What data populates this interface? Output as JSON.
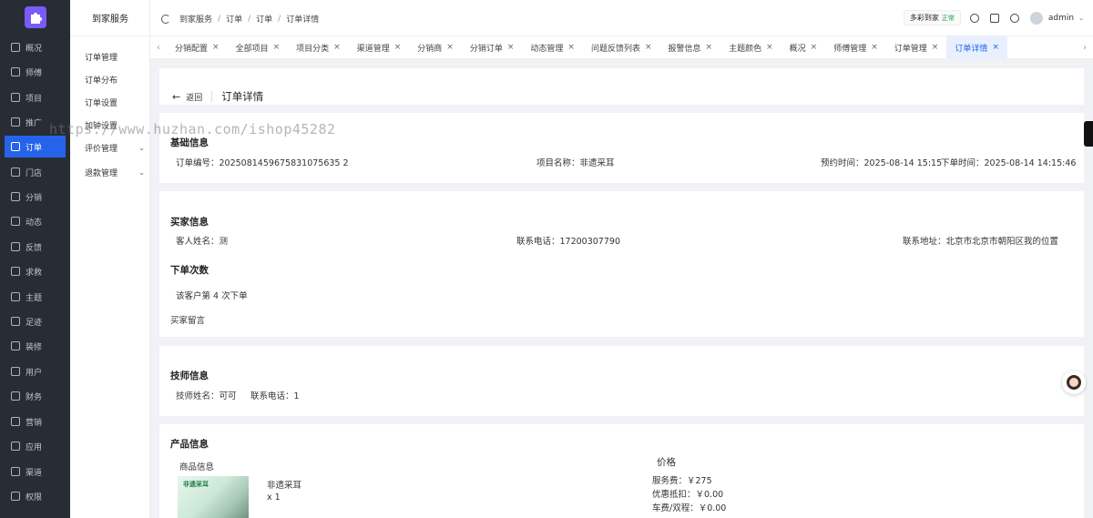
{
  "nav": {
    "items": [
      {
        "label": "概况",
        "icon": "grid-icon"
      },
      {
        "label": "师傅",
        "icon": "user-icon"
      },
      {
        "label": "项目",
        "icon": "folder-icon"
      },
      {
        "label": "推广",
        "icon": "promotion-icon"
      },
      {
        "label": "订单",
        "icon": "cart-icon",
        "active": true
      },
      {
        "label": "门店",
        "icon": "store-icon"
      },
      {
        "label": "分销",
        "icon": "share-icon"
      },
      {
        "label": "动态",
        "icon": "send-icon"
      },
      {
        "label": "反馈",
        "icon": "feedback-icon"
      },
      {
        "label": "求救",
        "icon": "help-icon"
      },
      {
        "label": "主题",
        "icon": "theme-icon"
      },
      {
        "label": "足迹",
        "icon": "clock-icon"
      },
      {
        "label": "装修",
        "icon": "decorate-icon"
      },
      {
        "label": "用户",
        "icon": "users-icon"
      },
      {
        "label": "财务",
        "icon": "finance-icon"
      },
      {
        "label": "营销",
        "icon": "marketing-icon"
      },
      {
        "label": "应用",
        "icon": "app-icon"
      },
      {
        "label": "渠道",
        "icon": "channel-icon"
      },
      {
        "label": "权限",
        "icon": "lock-icon"
      }
    ]
  },
  "subnav": {
    "title": "到家服务",
    "items": [
      {
        "label": "订单管理",
        "chevron": ""
      },
      {
        "label": "订单分布",
        "chevron": ""
      },
      {
        "label": "订单设置",
        "chevron": ""
      },
      {
        "label": "加钟设置",
        "chevron": ""
      },
      {
        "label": "评价管理",
        "chevron": "⌄"
      },
      {
        "label": "退款管理",
        "chevron": "⌄"
      }
    ]
  },
  "header": {
    "breadcrumbs": [
      "到家服务",
      "订单",
      "订单",
      "订单详情"
    ],
    "tenant": "多彩到家",
    "tenant_tag": "正常",
    "user": "admin"
  },
  "tabs": [
    {
      "label": "分销配置"
    },
    {
      "label": "全部项目"
    },
    {
      "label": "项目分类"
    },
    {
      "label": "渠道管理"
    },
    {
      "label": "分销商"
    },
    {
      "label": "分销订单"
    },
    {
      "label": "动态管理"
    },
    {
      "label": "问题反馈列表"
    },
    {
      "label": "报警信息"
    },
    {
      "label": "主题颜色"
    },
    {
      "label": "概况"
    },
    {
      "label": "师傅管理"
    },
    {
      "label": "订单管理"
    },
    {
      "label": "订单详情",
      "active": true
    }
  ],
  "page": {
    "back_label": "返回",
    "title": "订单详情"
  },
  "basic": {
    "title": "基础信息",
    "order_no": "订单编号：2025081459675831075635 2",
    "project": "项目名称：非遗采耳",
    "appointment": "预约时间：2025-08-14 15:15",
    "order_time": "下单时间：2025-08-14 14:15:46"
  },
  "buyer": {
    "title": "买家信息",
    "name": "客人姓名：测",
    "phone": "联系电话：17200307790",
    "address": "联系地址：北京市北京市朝阳区我的位置",
    "count_title": "下单次数",
    "count_text": "该客户第 4 次下单",
    "remark_title": "买家留言"
  },
  "tech": {
    "title": "技师信息",
    "name": "技师姓名：可可",
    "phone": "联系电话：1"
  },
  "product": {
    "title": "产品信息",
    "goods_header": "商品信息",
    "price_header": "价格",
    "thumb_text": "非遗采耳",
    "name": "非遗采耳",
    "qty": "x 1",
    "service_fee": "服务费：￥275",
    "discount": "优惠抵扣：￥0.00",
    "travel_fee": "车费/双程：￥0.00"
  },
  "watermark": "https://www.huzhan.com/ishop45282"
}
